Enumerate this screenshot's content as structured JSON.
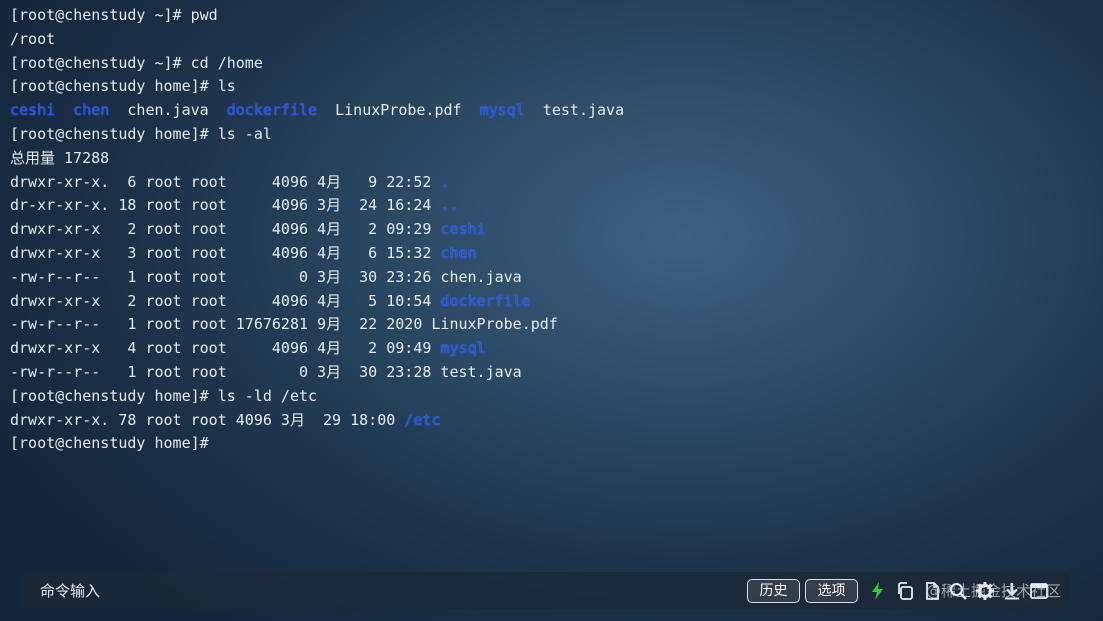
{
  "terminal": {
    "lines": [
      [
        {
          "t": "[root@chenstudy ~]# pwd"
        }
      ],
      [
        {
          "t": "/root"
        }
      ],
      [
        {
          "t": "[root@chenstudy ~]# cd /home"
        }
      ],
      [
        {
          "t": "[root@chenstudy home]# ls"
        }
      ],
      [
        {
          "t": "ceshi",
          "dir": true
        },
        {
          "t": "  "
        },
        {
          "t": "chen",
          "dir": true
        },
        {
          "t": "  chen.java  "
        },
        {
          "t": "dockerfile",
          "dir": true
        },
        {
          "t": "  LinuxProbe.pdf  "
        },
        {
          "t": "mysql",
          "dir": true
        },
        {
          "t": "  test.java"
        }
      ],
      [
        {
          "t": "[root@chenstudy home]# ls -al"
        }
      ],
      [
        {
          "t": "总用量 17288"
        }
      ],
      [
        {
          "t": "drwxr-xr-x.  6 root root     4096 4月   9 22:52 "
        },
        {
          "t": ".",
          "dir": true
        }
      ],
      [
        {
          "t": "dr-xr-xr-x. 18 root root     4096 3月  24 16:24 "
        },
        {
          "t": "..",
          "dir": true
        }
      ],
      [
        {
          "t": "drwxr-xr-x   2 root root     4096 4月   2 09:29 "
        },
        {
          "t": "ceshi",
          "dir": true
        }
      ],
      [
        {
          "t": "drwxr-xr-x   3 root root     4096 4月   6 15:32 "
        },
        {
          "t": "chen",
          "dir": true
        }
      ],
      [
        {
          "t": "-rw-r--r--   1 root root        0 3月  30 23:26 chen.java"
        }
      ],
      [
        {
          "t": "drwxr-xr-x   2 root root     4096 4月   5 10:54 "
        },
        {
          "t": "dockerfile",
          "dir": true
        }
      ],
      [
        {
          "t": "-rw-r--r--   1 root root 17676281 9月  22 2020 LinuxProbe.pdf"
        }
      ],
      [
        {
          "t": "drwxr-xr-x   4 root root     4096 4月   2 09:49 "
        },
        {
          "t": "mysql",
          "dir": true
        }
      ],
      [
        {
          "t": "-rw-r--r--   1 root root        0 3月  30 23:28 test.java"
        }
      ],
      [
        {
          "t": "[root@chenstudy home]# ls -ld /etc"
        }
      ],
      [
        {
          "t": "drwxr-xr-x. 78 root root 4096 3月  29 18:00 "
        },
        {
          "t": "/etc",
          "dir": true
        }
      ],
      [
        {
          "t": "[root@chenstudy home]#"
        }
      ]
    ]
  },
  "bottom_bar": {
    "input_label": "命令输入",
    "history_button": "历史",
    "options_button": "选项",
    "icons": [
      "bolt-icon",
      "copy-icon",
      "file-icon",
      "search-icon",
      "gear-icon",
      "download-icon",
      "fullscreen-icon"
    ],
    "watermark": "@稀土掘金技术社区"
  },
  "colors": {
    "directory": "#1f4ff0",
    "text": "#e4e9ee",
    "bolt": "#2ed12e",
    "background": "#2c4a66"
  }
}
